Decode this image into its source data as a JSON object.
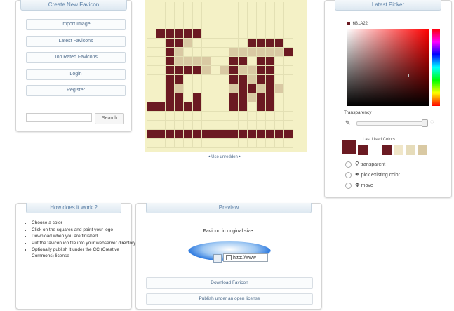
{
  "sidebar": {
    "header": "Create New Favicon",
    "items": [
      {
        "label": "Import Image"
      },
      {
        "label": "Latest Favicons"
      },
      {
        "label": "Top Rated Favicons"
      },
      {
        "label": "Login"
      },
      {
        "label": "Register"
      }
    ],
    "search": {
      "placeholder": "",
      "button": "Search"
    }
  },
  "editor": {
    "undo_link": "• Use unredden •",
    "grid_pattern": [
      "................",
      "................",
      "................",
      ".ddddd..........",
      "..ddl......dddd.",
      "..dl.....lllllld",
      "..dllll..dd.dd..",
      "..ddddl.ldlldd..",
      "..dd.....ddldd..",
      "..dl.....lddldl.",
      "..dd.d...ddldd..",
      "dddddd...dd.dd..",
      "................",
      "................",
      "dddddddddddddddd",
      "................"
    ],
    "colors": {
      "d": "#6b1a22",
      "l": "#d9c9a3",
      "bg": "#f4f1c6"
    }
  },
  "picker": {
    "header": "Latest Picker",
    "hex_value": "#6b1a22",
    "hex_label": "6B1A22",
    "transparency_label": "Transparency",
    "last_used_label": "Last Used Colors",
    "last_used": [
      "#6b1a22",
      "#6b1a22",
      "#ffffff",
      "#6b1a22",
      "#f0e6c8",
      "#e6dcba",
      "#d9c9a3"
    ],
    "options": [
      {
        "label": "transparent",
        "icon": "wrench-icon"
      },
      {
        "label": "pick existing color",
        "icon": "eyedropper-icon"
      },
      {
        "label": "move",
        "icon": "move-arrows-icon"
      }
    ]
  },
  "how": {
    "header": "How does it work ?",
    "steps": [
      "Choose a color",
      "Click on the squares and paint your logo",
      "Download when you are finished",
      "Put the favicon.ico file into your webserver directory",
      "Optionally publish it under the CC (Creative Commons) license"
    ]
  },
  "preview": {
    "header": "Preview",
    "caption": "Favicon in original size:",
    "url_text": "http://www",
    "download_button": "Download Favicon",
    "publish_button": "Publish under an open license"
  }
}
